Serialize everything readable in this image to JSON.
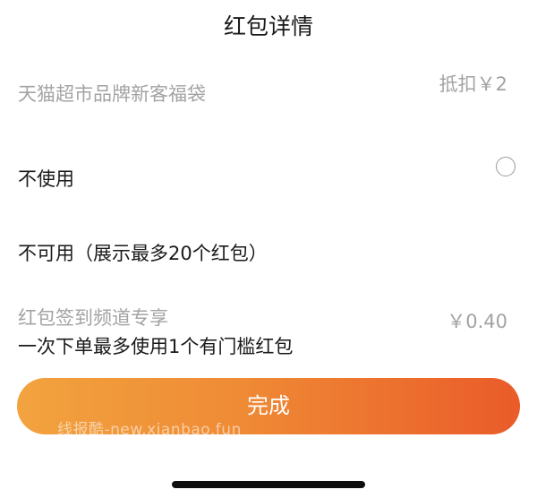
{
  "title": "红包详情",
  "coupons": [
    {
      "name": "天猫超市品牌新客福袋",
      "amount": "抵扣￥2"
    },
    {
      "name": "红包签到频道专享",
      "amount": "￥0.40",
      "note": "一次下单最多使用1个有门槛红包"
    }
  ],
  "no_use_label": "不使用",
  "unavailable_label": "不可用（展示最多20个红包）",
  "confirm_button": "完成",
  "watermark": "线报酷-new.xianbao.fun",
  "colors": {
    "button_gradient_start": "#f2a33f",
    "button_gradient_end": "#ea5b29",
    "muted_text": "#a3a3a3"
  }
}
